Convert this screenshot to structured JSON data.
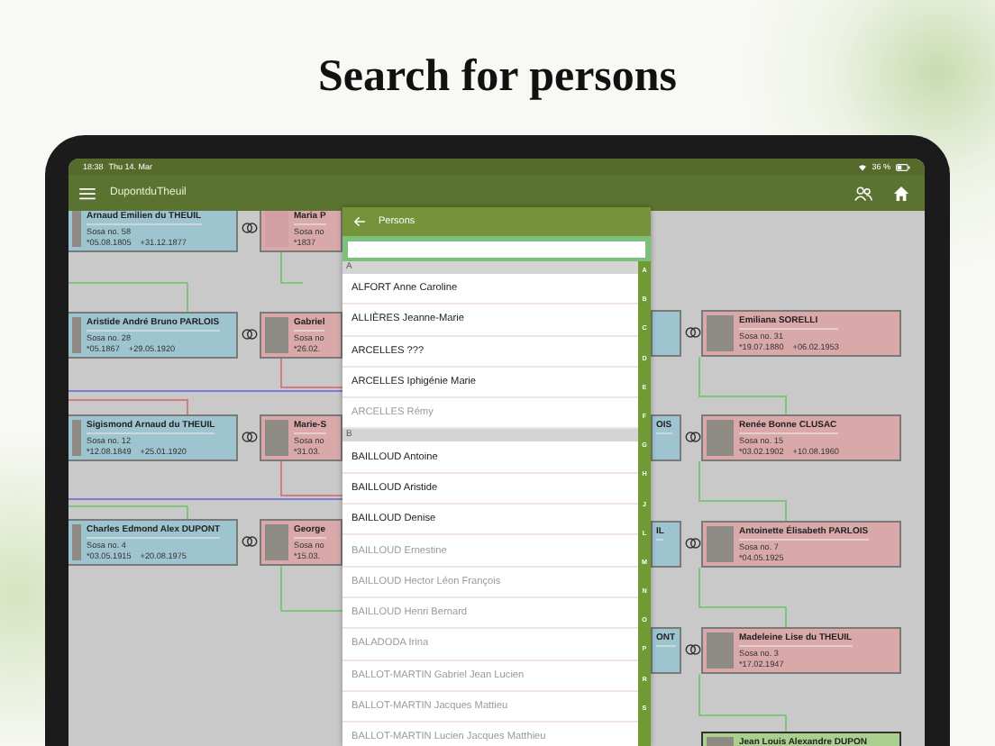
{
  "headline": "Search for persons",
  "status_bar": {
    "time": "18:38",
    "date": "Thu 14. Mar",
    "battery": "36 %"
  },
  "app_bar": {
    "title": "DupontduTheuil"
  },
  "tree": {
    "cards": [
      {
        "kind": "male",
        "name": "Arnaud Emilien du THEUIL",
        "sosa": "Sosa no. 58",
        "born": "*05.08.1805",
        "died": "+31.12.1877",
        "photo": true
      },
      {
        "kind": "female",
        "name": "Maria P",
        "sosa": "Sosa no",
        "born": "*1837",
        "photo": false
      },
      {
        "kind": "male",
        "name": "Aristide André Bruno PARLOIS",
        "sosa": "Sosa no. 28",
        "born": "*05.1867",
        "died": "+29.05.1920",
        "photo": true
      },
      {
        "kind": "female",
        "name": "Gabriel",
        "sosa": "Sosa no",
        "born": "*26.02.",
        "photo": true
      },
      {
        "kind": "male",
        "name": "Sigismond Arnaud du THEUIL",
        "sosa": "Sosa no. 12",
        "born": "*12.08.1849",
        "died": "+25.01.1920",
        "photo": true
      },
      {
        "kind": "female",
        "name": "Marie-S",
        "sosa": "Sosa no",
        "born": "*31.03.",
        "photo": true
      },
      {
        "kind": "male",
        "name": "Charles Edmond Alex DUPONT",
        "sosa": "Sosa no. 4",
        "born": "*03.05.1915",
        "died": "+20.08.1975",
        "photo": true
      },
      {
        "kind": "female",
        "name": "George",
        "sosa": "Sosa no",
        "born": "*15.03.",
        "photo": true
      },
      {
        "kind": "male"
      },
      {
        "kind": "female",
        "name": "Emiliana SORELLI",
        "sosa": "Sosa no. 31",
        "born": "*19.07.1880",
        "died": "+06.02.1953",
        "photo": true
      },
      {
        "kind": "male",
        "name": "OIS"
      },
      {
        "kind": "female",
        "name": "Renée Bonne CLUSAC",
        "sosa": "Sosa no. 15",
        "born": "*03.02.1902",
        "died": "+10.08.1960",
        "photo": true
      },
      {
        "kind": "male",
        "name": "IL"
      },
      {
        "kind": "female",
        "name": "Antoinette Élisabeth PARLOIS",
        "sosa": "Sosa no. 7",
        "born": "*04.05.1925",
        "photo": true
      },
      {
        "kind": "male",
        "name": "ONT"
      },
      {
        "kind": "female",
        "name": "Madeleine Lise du THEUIL",
        "sosa": "Sosa no. 3",
        "born": "*17.02.1947",
        "photo": true
      },
      {
        "kind": "root",
        "name": "Jean Louis Alexandre DUPON",
        "photo": true
      }
    ]
  },
  "persons_panel": {
    "title": "Persons",
    "sections": [
      {
        "letter": "A",
        "people": [
          {
            "name": "ALFORT Anne Caroline",
            "dimmed": false
          },
          {
            "name": "ALLIÈRES Jeanne-Marie",
            "dimmed": false
          },
          {
            "name": "ARCELLES ???",
            "dimmed": false
          },
          {
            "name": "ARCELLES Iphigénie Marie",
            "dimmed": false
          },
          {
            "name": "ARCELLES Rémy",
            "dimmed": true
          }
        ]
      },
      {
        "letter": "B",
        "people": [
          {
            "name": "BAILLOUD Antoine",
            "dimmed": false
          },
          {
            "name": "BAILLOUD Aristide",
            "dimmed": false
          },
          {
            "name": "BAILLOUD Denise",
            "dimmed": false
          },
          {
            "name": "BAILLOUD Ernestine",
            "dimmed": true
          },
          {
            "name": "BAILLOUD Hector Léon François",
            "dimmed": true
          },
          {
            "name": "BAILLOUD Henri Bernard",
            "dimmed": true
          },
          {
            "name": "BALADODA Irina",
            "dimmed": true
          },
          {
            "name": "BALLOT-MARTIN Gabriel Jean Lucien",
            "dimmed": true
          },
          {
            "name": "BALLOT-MARTIN Jacques Mattieu",
            "dimmed": true
          },
          {
            "name": "BALLOT-MARTIN Lucien Jacques Matthieu",
            "dimmed": true
          }
        ]
      }
    ],
    "index_letters": [
      "A",
      "B",
      "C",
      "D",
      "E",
      "F",
      "G",
      "H",
      "J",
      "L",
      "M",
      "N",
      "O",
      "P",
      "R",
      "S"
    ]
  }
}
